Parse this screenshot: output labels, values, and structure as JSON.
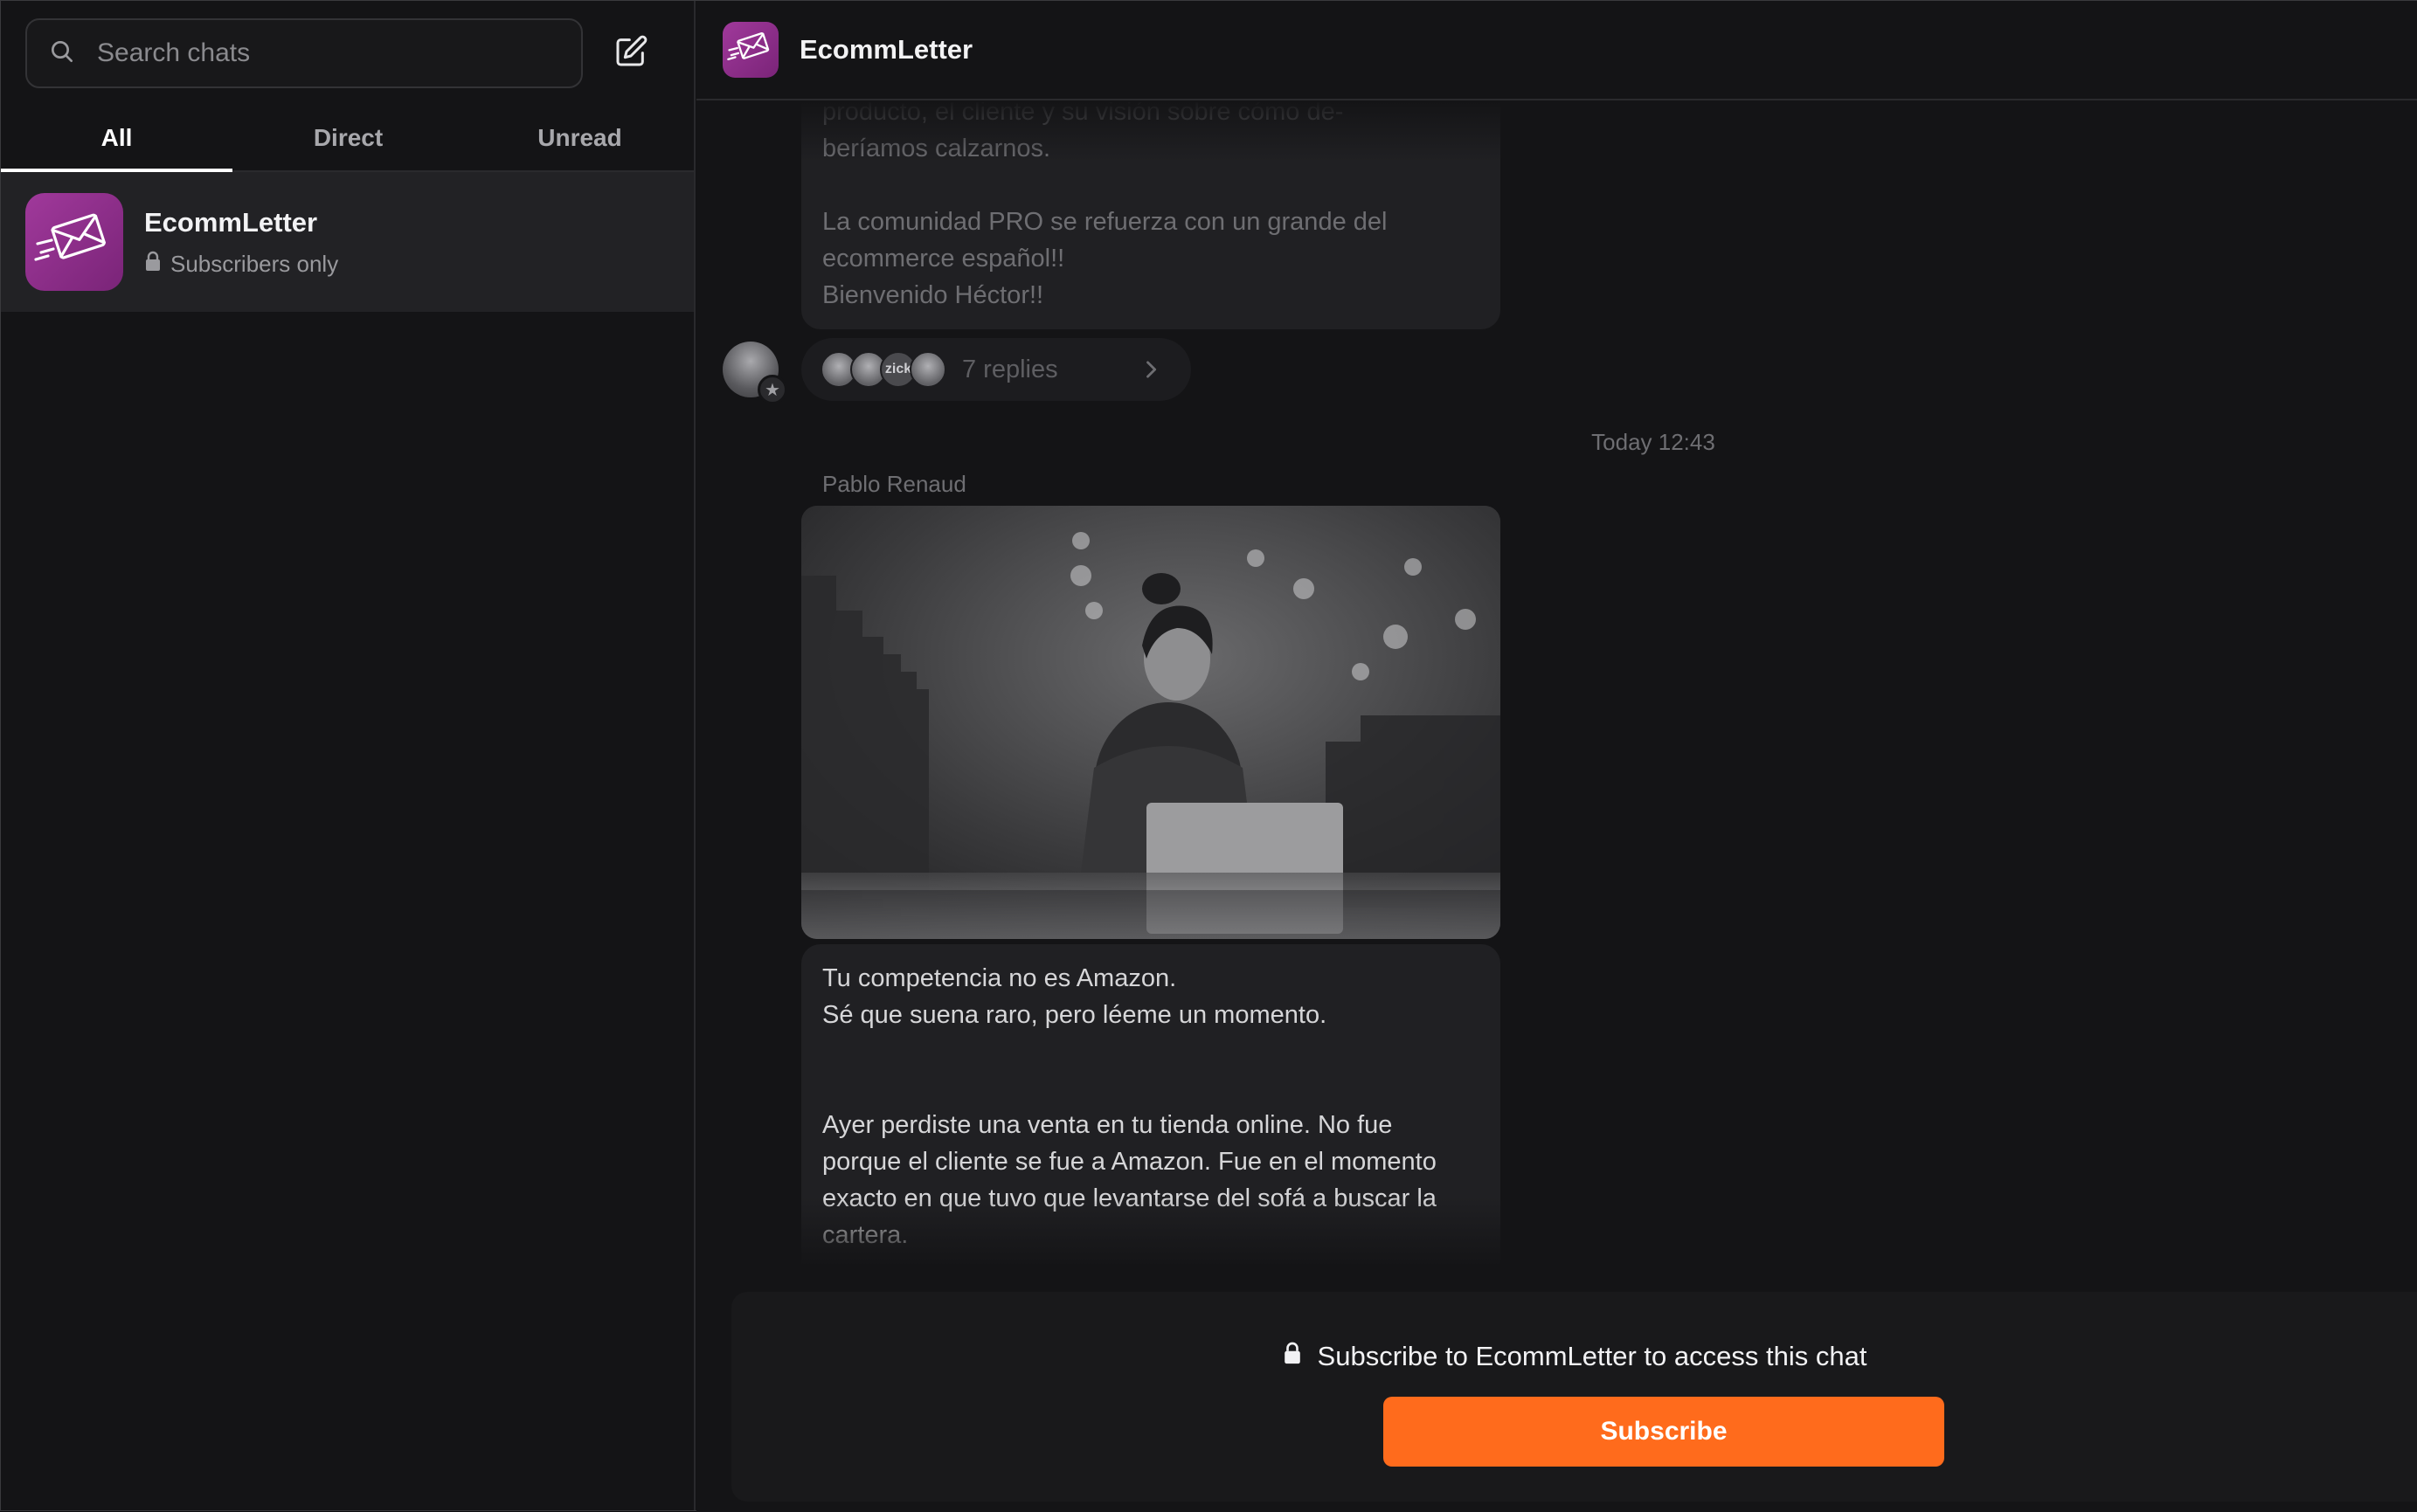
{
  "sidebar": {
    "search": {
      "placeholder": "Search chats",
      "value": ""
    },
    "tabs": [
      {
        "label": "All",
        "active": true
      },
      {
        "label": "Direct",
        "active": false
      },
      {
        "label": "Unread",
        "active": false
      }
    ],
    "chats": [
      {
        "name": "EcommLetter",
        "subtitle": "Subscribers only",
        "icon": "envelope-icon"
      }
    ]
  },
  "header": {
    "title": "EcommLetter",
    "icon": "envelope-icon"
  },
  "messages": {
    "previous": {
      "lines": [
        "producto, el cliente y su visión sobre cómo de-",
        "beríamos calzarnos.",
        "La comunidad PRO se refuerza con un grande del",
        "ecommerce español!!",
        "Bienvenido Héctor!!"
      ],
      "replies_label": "7 replies",
      "reply_avatar_text": "zick"
    },
    "date_separator": "Today 12:43",
    "current": {
      "sender": "Pablo Renaud",
      "image_alt": "Woman working on a laptop in a clothing store",
      "paragraph1": [
        "Tu competencia no es Amazon.",
        "Sé que suena raro, pero léeme un momento."
      ],
      "paragraph2": [
        "Ayer perdiste una venta en tu tienda online. No fue",
        "porque el cliente se fue a Amazon. Fue en el momento",
        "exacto en que tuvo que levantarse del sofá a buscar la",
        "cartera."
      ]
    }
  },
  "subscribe": {
    "message": "Subscribe to EcommLetter to access this chat",
    "button_label": "Subscribe"
  },
  "colors": {
    "accent": "#ff6b1c",
    "brand_purple": "#9b3596",
    "background": "#141416"
  }
}
